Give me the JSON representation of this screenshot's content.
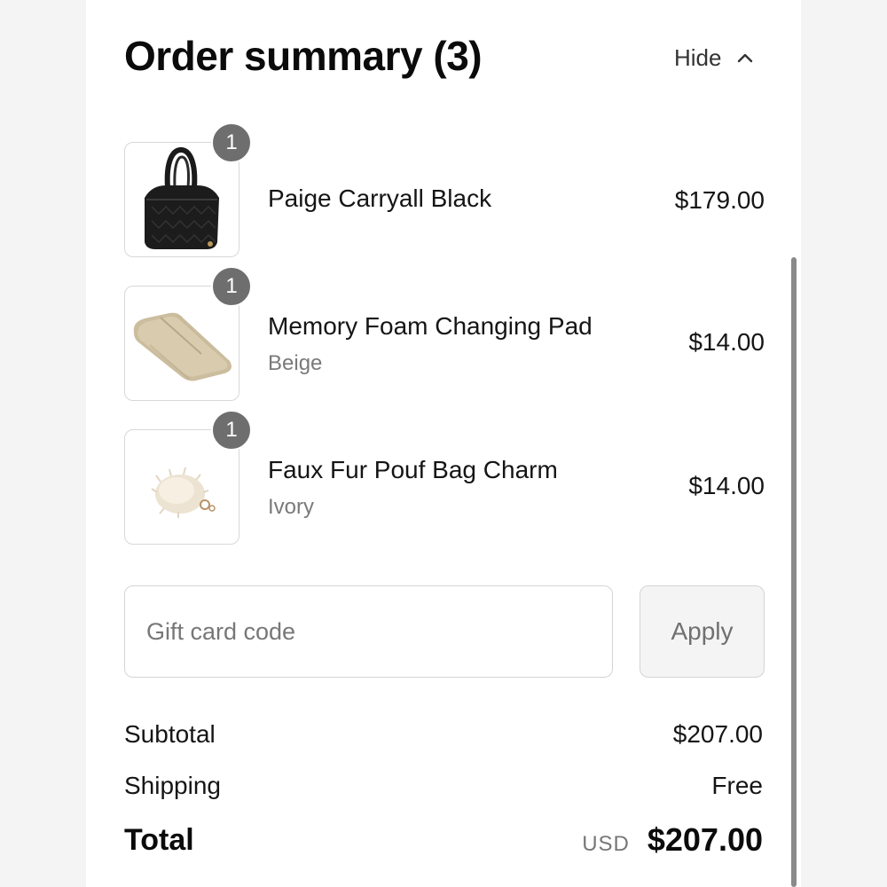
{
  "header": {
    "title": "Order summary (3)",
    "toggle_label": "Hide",
    "toggle_icon": "chevron-up-icon"
  },
  "items": [
    {
      "quantity": "1",
      "name": "Paige Carryall Black",
      "variant": "",
      "price": "$179.00",
      "image": "black-quilted-handbag"
    },
    {
      "quantity": "1",
      "name": "Memory Foam Changing Pad",
      "variant": "Beige",
      "price": "$14.00",
      "image": "beige-changing-pad"
    },
    {
      "quantity": "1",
      "name": "Faux Fur Pouf Bag Charm",
      "variant": "Ivory",
      "price": "$14.00",
      "image": "ivory-fur-pouf-charm"
    }
  ],
  "gift_card": {
    "placeholder": "Gift card code",
    "value": "",
    "apply_label": "Apply"
  },
  "totals": {
    "subtotal_label": "Subtotal",
    "subtotal_value": "$207.00",
    "shipping_label": "Shipping",
    "shipping_value": "Free",
    "total_label": "Total",
    "currency": "USD",
    "total_value": "$207.00"
  },
  "colors": {
    "badge": "#6e6e6e",
    "border": "#d4d4d4",
    "muted_text": "#7a7a7a",
    "button_bg": "#f4f4f4"
  }
}
